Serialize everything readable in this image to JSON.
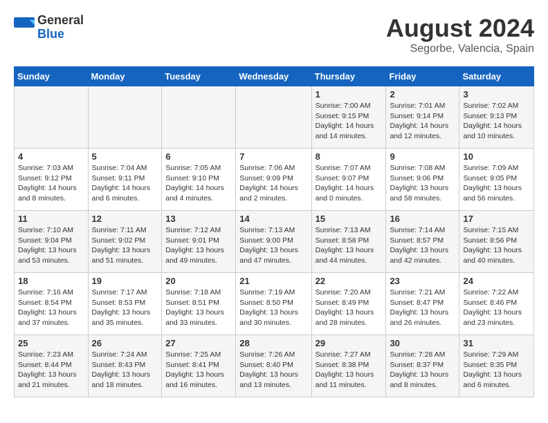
{
  "logo": {
    "general": "General",
    "blue": "Blue"
  },
  "title": "August 2024",
  "location": "Segorbe, Valencia, Spain",
  "days_of_week": [
    "Sunday",
    "Monday",
    "Tuesday",
    "Wednesday",
    "Thursday",
    "Friday",
    "Saturday"
  ],
  "weeks": [
    [
      {
        "day": "",
        "info": ""
      },
      {
        "day": "",
        "info": ""
      },
      {
        "day": "",
        "info": ""
      },
      {
        "day": "",
        "info": ""
      },
      {
        "day": "1",
        "info": "Sunrise: 7:00 AM\nSunset: 9:15 PM\nDaylight: 14 hours\nand 14 minutes."
      },
      {
        "day": "2",
        "info": "Sunrise: 7:01 AM\nSunset: 9:14 PM\nDaylight: 14 hours\nand 12 minutes."
      },
      {
        "day": "3",
        "info": "Sunrise: 7:02 AM\nSunset: 9:13 PM\nDaylight: 14 hours\nand 10 minutes."
      }
    ],
    [
      {
        "day": "4",
        "info": "Sunrise: 7:03 AM\nSunset: 9:12 PM\nDaylight: 14 hours\nand 8 minutes."
      },
      {
        "day": "5",
        "info": "Sunrise: 7:04 AM\nSunset: 9:11 PM\nDaylight: 14 hours\nand 6 minutes."
      },
      {
        "day": "6",
        "info": "Sunrise: 7:05 AM\nSunset: 9:10 PM\nDaylight: 14 hours\nand 4 minutes."
      },
      {
        "day": "7",
        "info": "Sunrise: 7:06 AM\nSunset: 9:09 PM\nDaylight: 14 hours\nand 2 minutes."
      },
      {
        "day": "8",
        "info": "Sunrise: 7:07 AM\nSunset: 9:07 PM\nDaylight: 14 hours\nand 0 minutes."
      },
      {
        "day": "9",
        "info": "Sunrise: 7:08 AM\nSunset: 9:06 PM\nDaylight: 13 hours\nand 58 minutes."
      },
      {
        "day": "10",
        "info": "Sunrise: 7:09 AM\nSunset: 9:05 PM\nDaylight: 13 hours\nand 56 minutes."
      }
    ],
    [
      {
        "day": "11",
        "info": "Sunrise: 7:10 AM\nSunset: 9:04 PM\nDaylight: 13 hours\nand 53 minutes."
      },
      {
        "day": "12",
        "info": "Sunrise: 7:11 AM\nSunset: 9:02 PM\nDaylight: 13 hours\nand 51 minutes."
      },
      {
        "day": "13",
        "info": "Sunrise: 7:12 AM\nSunset: 9:01 PM\nDaylight: 13 hours\nand 49 minutes."
      },
      {
        "day": "14",
        "info": "Sunrise: 7:13 AM\nSunset: 9:00 PM\nDaylight: 13 hours\nand 47 minutes."
      },
      {
        "day": "15",
        "info": "Sunrise: 7:13 AM\nSunset: 8:58 PM\nDaylight: 13 hours\nand 44 minutes."
      },
      {
        "day": "16",
        "info": "Sunrise: 7:14 AM\nSunset: 8:57 PM\nDaylight: 13 hours\nand 42 minutes."
      },
      {
        "day": "17",
        "info": "Sunrise: 7:15 AM\nSunset: 8:56 PM\nDaylight: 13 hours\nand 40 minutes."
      }
    ],
    [
      {
        "day": "18",
        "info": "Sunrise: 7:16 AM\nSunset: 8:54 PM\nDaylight: 13 hours\nand 37 minutes."
      },
      {
        "day": "19",
        "info": "Sunrise: 7:17 AM\nSunset: 8:53 PM\nDaylight: 13 hours\nand 35 minutes."
      },
      {
        "day": "20",
        "info": "Sunrise: 7:18 AM\nSunset: 8:51 PM\nDaylight: 13 hours\nand 33 minutes."
      },
      {
        "day": "21",
        "info": "Sunrise: 7:19 AM\nSunset: 8:50 PM\nDaylight: 13 hours\nand 30 minutes."
      },
      {
        "day": "22",
        "info": "Sunrise: 7:20 AM\nSunset: 8:49 PM\nDaylight: 13 hours\nand 28 minutes."
      },
      {
        "day": "23",
        "info": "Sunrise: 7:21 AM\nSunset: 8:47 PM\nDaylight: 13 hours\nand 26 minutes."
      },
      {
        "day": "24",
        "info": "Sunrise: 7:22 AM\nSunset: 8:46 PM\nDaylight: 13 hours\nand 23 minutes."
      }
    ],
    [
      {
        "day": "25",
        "info": "Sunrise: 7:23 AM\nSunset: 8:44 PM\nDaylight: 13 hours\nand 21 minutes."
      },
      {
        "day": "26",
        "info": "Sunrise: 7:24 AM\nSunset: 8:43 PM\nDaylight: 13 hours\nand 18 minutes."
      },
      {
        "day": "27",
        "info": "Sunrise: 7:25 AM\nSunset: 8:41 PM\nDaylight: 13 hours\nand 16 minutes."
      },
      {
        "day": "28",
        "info": "Sunrise: 7:26 AM\nSunset: 8:40 PM\nDaylight: 13 hours\nand 13 minutes."
      },
      {
        "day": "29",
        "info": "Sunrise: 7:27 AM\nSunset: 8:38 PM\nDaylight: 13 hours\nand 11 minutes."
      },
      {
        "day": "30",
        "info": "Sunrise: 7:28 AM\nSunset: 8:37 PM\nDaylight: 13 hours\nand 8 minutes."
      },
      {
        "day": "31",
        "info": "Sunrise: 7:29 AM\nSunset: 8:35 PM\nDaylight: 13 hours\nand 6 minutes."
      }
    ]
  ]
}
